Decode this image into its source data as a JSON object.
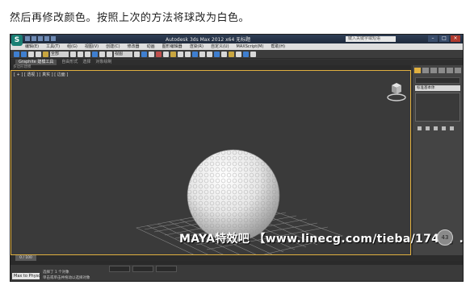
{
  "caption": "然后再修改颜色。按照上次的方法将球改为白色。",
  "window": {
    "title": "Autodesk 3ds Max  2012 x64    无标题",
    "search_placeholder": "键入关键字或短语",
    "min": "–",
    "max": "□",
    "close": "×"
  },
  "menu": [
    "编辑(E)",
    "工具(T)",
    "组(G)",
    "视图(V)",
    "创建(C)",
    "修改器",
    "动画",
    "图形编辑器",
    "渲染(R)",
    "自定义(U)",
    "MAXScript(M)",
    "帮助(H)"
  ],
  "toolbar": {
    "selection_filter": "全部",
    "view_mode": "视图"
  },
  "ribbon": {
    "tabs": [
      "Graphite 建模工具",
      "自由形式",
      "选择",
      "对象绘制"
    ],
    "active": 0
  },
  "subbar": "多边形建模",
  "viewport": {
    "label": "[ + ] [ 透视 ] [ 真实 ] [ 边面 ]"
  },
  "command_panel": {
    "dropdown": "标准基本体"
  },
  "timeline": {
    "frame": "0 / 100"
  },
  "status": {
    "listener": "Max to Physc.",
    "line1": "选择了 1 个对象",
    "line2": "单击或单击并拖动以选择对象"
  },
  "watermark": "MAYA特效吧 【www.linecg.com/tieba/1745】.",
  "badge": "43"
}
